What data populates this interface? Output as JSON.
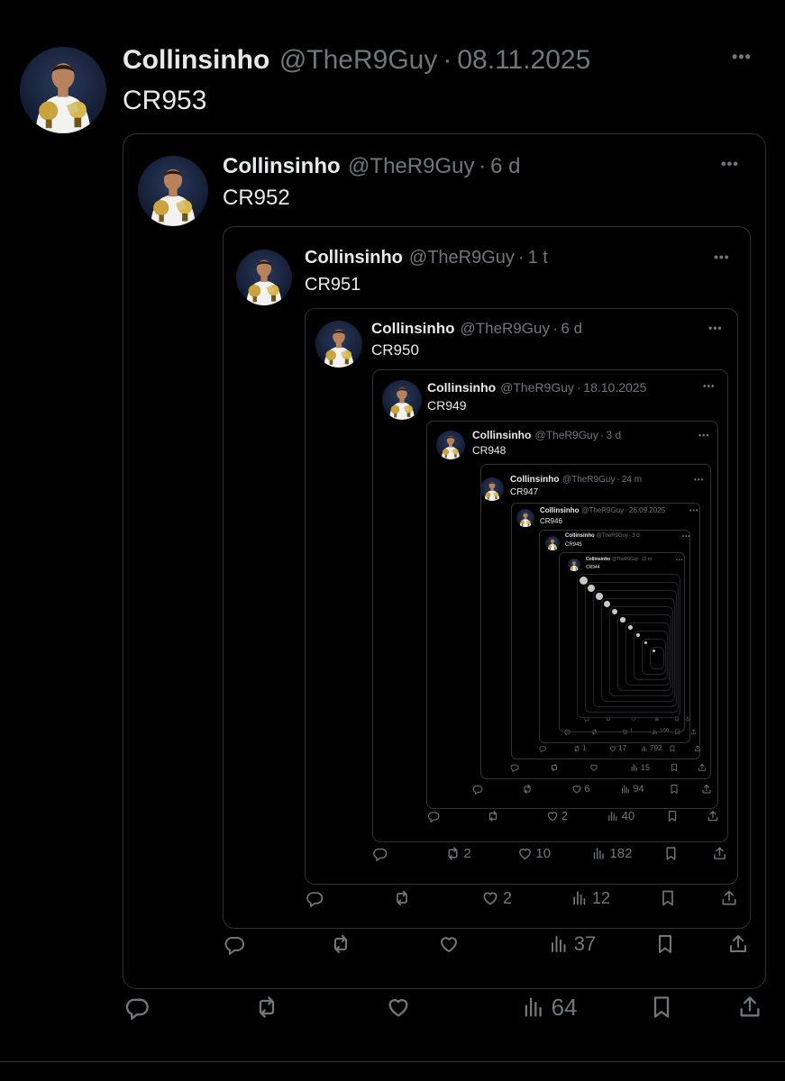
{
  "tweets": [
    {
      "name": "Collinsinho",
      "handle": "@TheR9Guy",
      "sep": "·",
      "time": "08.11.2025",
      "text": "CR953",
      "more": "•••",
      "actions": {
        "reply": "",
        "retweet": "",
        "like": "",
        "views": "64"
      }
    },
    {
      "name": "Collinsinho",
      "handle": "@TheR9Guy",
      "sep": "·",
      "time": "6 d",
      "text": "CR952",
      "more": "•••",
      "actions": {
        "reply": "",
        "retweet": "",
        "like": "",
        "views": "37"
      }
    },
    {
      "name": "Collinsinho",
      "handle": "@TheR9Guy",
      "sep": "·",
      "time": "1 t",
      "text": "CR951",
      "more": "•••",
      "actions": {
        "reply": "",
        "retweet": "",
        "like": "2",
        "views": "12"
      }
    },
    {
      "name": "Collinsinho",
      "handle": "@TheR9Guy",
      "sep": "·",
      "time": "6 d",
      "text": "CR950",
      "more": "•••",
      "actions": {
        "reply": "",
        "retweet": "2",
        "like": "10",
        "views": "182"
      }
    },
    {
      "name": "Collinsinho",
      "handle": "@TheR9Guy",
      "sep": "·",
      "time": "18.10.2025",
      "text": "CR949",
      "more": "•••",
      "actions": {
        "reply": "",
        "retweet": "",
        "like": "2",
        "views": "40"
      }
    },
    {
      "name": "Collinsinho",
      "handle": "@TheR9Guy",
      "sep": "·",
      "time": "3 d",
      "text": "CR948",
      "more": "•••",
      "actions": {
        "reply": "",
        "retweet": "",
        "like": "6",
        "views": "94"
      }
    },
    {
      "name": "Collinsinho",
      "handle": "@TheR9Guy",
      "sep": "·",
      "time": "24 m",
      "text": "CR947",
      "more": "•••",
      "actions": {
        "reply": "",
        "retweet": "",
        "like": "",
        "views": "15"
      }
    },
    {
      "name": "Collinsinho",
      "handle": "@TheR9Guy",
      "sep": "·",
      "time": "26.09.2025",
      "text": "CR946",
      "more": "•••",
      "actions": {
        "reply": "",
        "retweet": "1",
        "like": "17",
        "views": "792"
      }
    },
    {
      "name": "Collinsinho",
      "handle": "@TheR9Guy",
      "sep": "·",
      "time": "3 d",
      "text": "CR945",
      "more": "•••",
      "actions": {
        "reply": "",
        "retweet": "",
        "like": "1",
        "views": "109"
      }
    },
    {
      "name": "Collinsinho",
      "handle": "@TheR9Guy",
      "sep": "·",
      "time": "12 m",
      "text": "CR944",
      "more": "•••",
      "actions": {
        "reply": "",
        "retweet": "",
        "like": "",
        "views": ""
      }
    }
  ],
  "icons": {
    "reply": "reply-icon",
    "retweet": "retweet-icon",
    "like": "heart-icon",
    "views": "views-icon",
    "bookmark": "bookmark-icon",
    "share": "share-icon",
    "more": "more-icon"
  },
  "colors": {
    "background": "#000000",
    "text": "#e7e9ea",
    "muted": "#71767b",
    "border": "#2f3336"
  }
}
